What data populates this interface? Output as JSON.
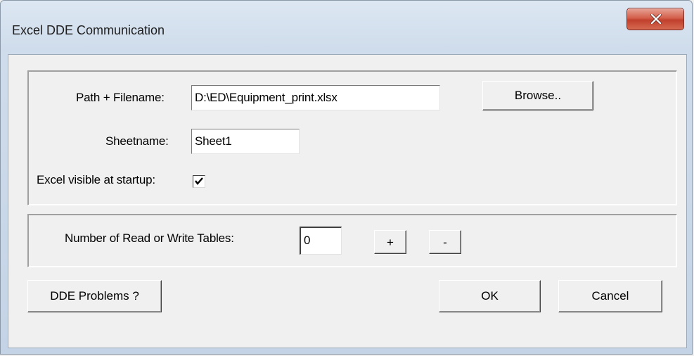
{
  "window": {
    "title": "Excel DDE Communication",
    "close_icon": "close-icon"
  },
  "file_group": {
    "path_label": "Path + Filename:",
    "path_value": "D:\\ED\\Equipment_print.xlsx",
    "browse_label": "Browse..",
    "sheet_label": "Sheetname:",
    "sheet_value": "Sheet1",
    "visible_label": "Excel visible at startup:",
    "visible_checked": true
  },
  "tables_group": {
    "count_label": "Number of Read or Write Tables:",
    "count_value": "0",
    "plus_label": "+",
    "minus_label": "-"
  },
  "footer": {
    "dde_problems_label": "DDE Problems ?",
    "ok_label": "OK",
    "cancel_label": "Cancel"
  }
}
